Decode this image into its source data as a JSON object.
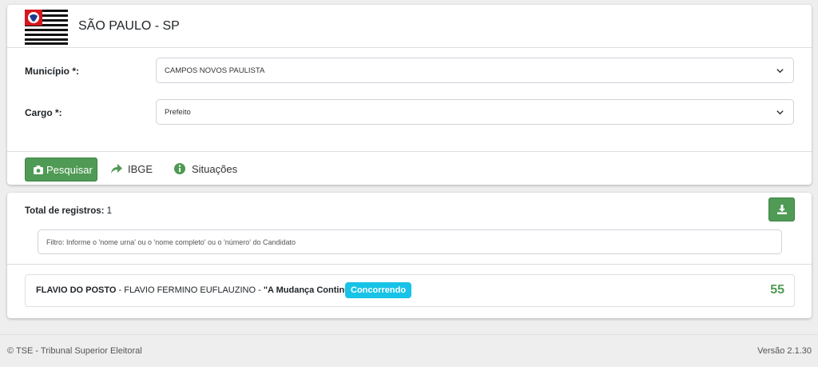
{
  "header": {
    "state_title": "SÃO PAULO - SP",
    "flag_icon": "sao-paulo-flag"
  },
  "form": {
    "municipio_label": "Município *:",
    "municipio_value": "CAMPOS NOVOS PAULISTA",
    "cargo_label": "Cargo *:",
    "cargo_value": "Prefeito"
  },
  "actions": {
    "search_label": "Pesquisar",
    "ibge_label": "IBGE",
    "situacoes_label": "Situações"
  },
  "results": {
    "total_label": "Total de registros:",
    "total_value": "1",
    "filter_placeholder": "Filtro: Informe o 'nome urna' ou o 'nome completo' ou o 'número' do Candidato",
    "items": [
      {
        "nome_urna": "FLAVIO DO POSTO",
        "sep1": " - ",
        "nome_completo": "FLAVIO FERMINO EUFLAUZINO",
        "sep2": " - ",
        "coligacao": "\"A Mudança Continua¿",
        "situacao": "Concorrendo",
        "numero": "55"
      }
    ]
  },
  "footer": {
    "copyright": "© TSE - Tribunal Superior Eleitoral",
    "version": "Versão 2.1.30"
  },
  "colors": {
    "primary_green": "#4f9a54",
    "badge_cyan": "#17c3e6",
    "background": "#eeeeee"
  }
}
